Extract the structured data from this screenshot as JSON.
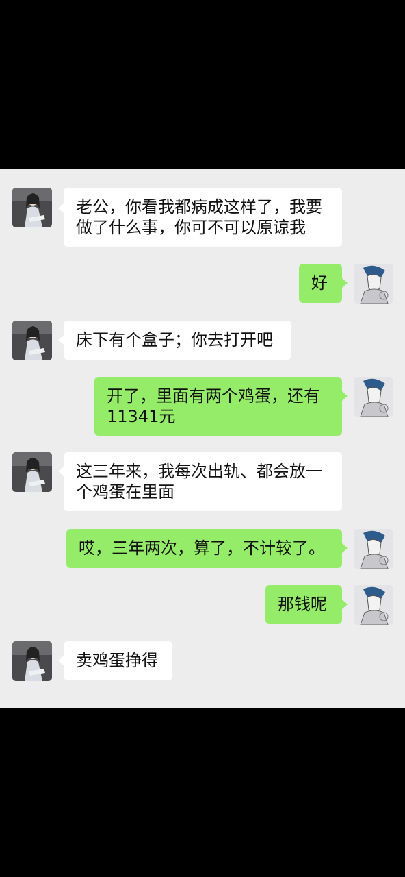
{
  "colors": {
    "chat_background": "#ededed",
    "incoming_bubble": "#ffffff",
    "outgoing_bubble": "#95ec69",
    "outer_background": "#000000"
  },
  "messages": [
    {
      "sender": "her",
      "lines": [
        "老公，你看我都病成这样了，我要",
        "做了什么事，你可不可以原谅我"
      ]
    },
    {
      "sender": "me",
      "lines": [
        "好"
      ]
    },
    {
      "sender": "her",
      "lines": [
        "床下有个盒子；你去打开吧"
      ]
    },
    {
      "sender": "me",
      "lines": [
        "开了，里面有两个鸡蛋，还有",
        "11341元"
      ]
    },
    {
      "sender": "her",
      "lines": [
        "这三年来，我每次出轨、都会放一",
        "个鸡蛋在里面"
      ]
    },
    {
      "sender": "me",
      "lines": [
        "哎，三年两次，算了，不计较了。"
      ]
    },
    {
      "sender": "me",
      "lines": [
        "那钱呢"
      ]
    },
    {
      "sender": "her",
      "lines": [
        "卖鸡蛋挣得"
      ]
    }
  ]
}
